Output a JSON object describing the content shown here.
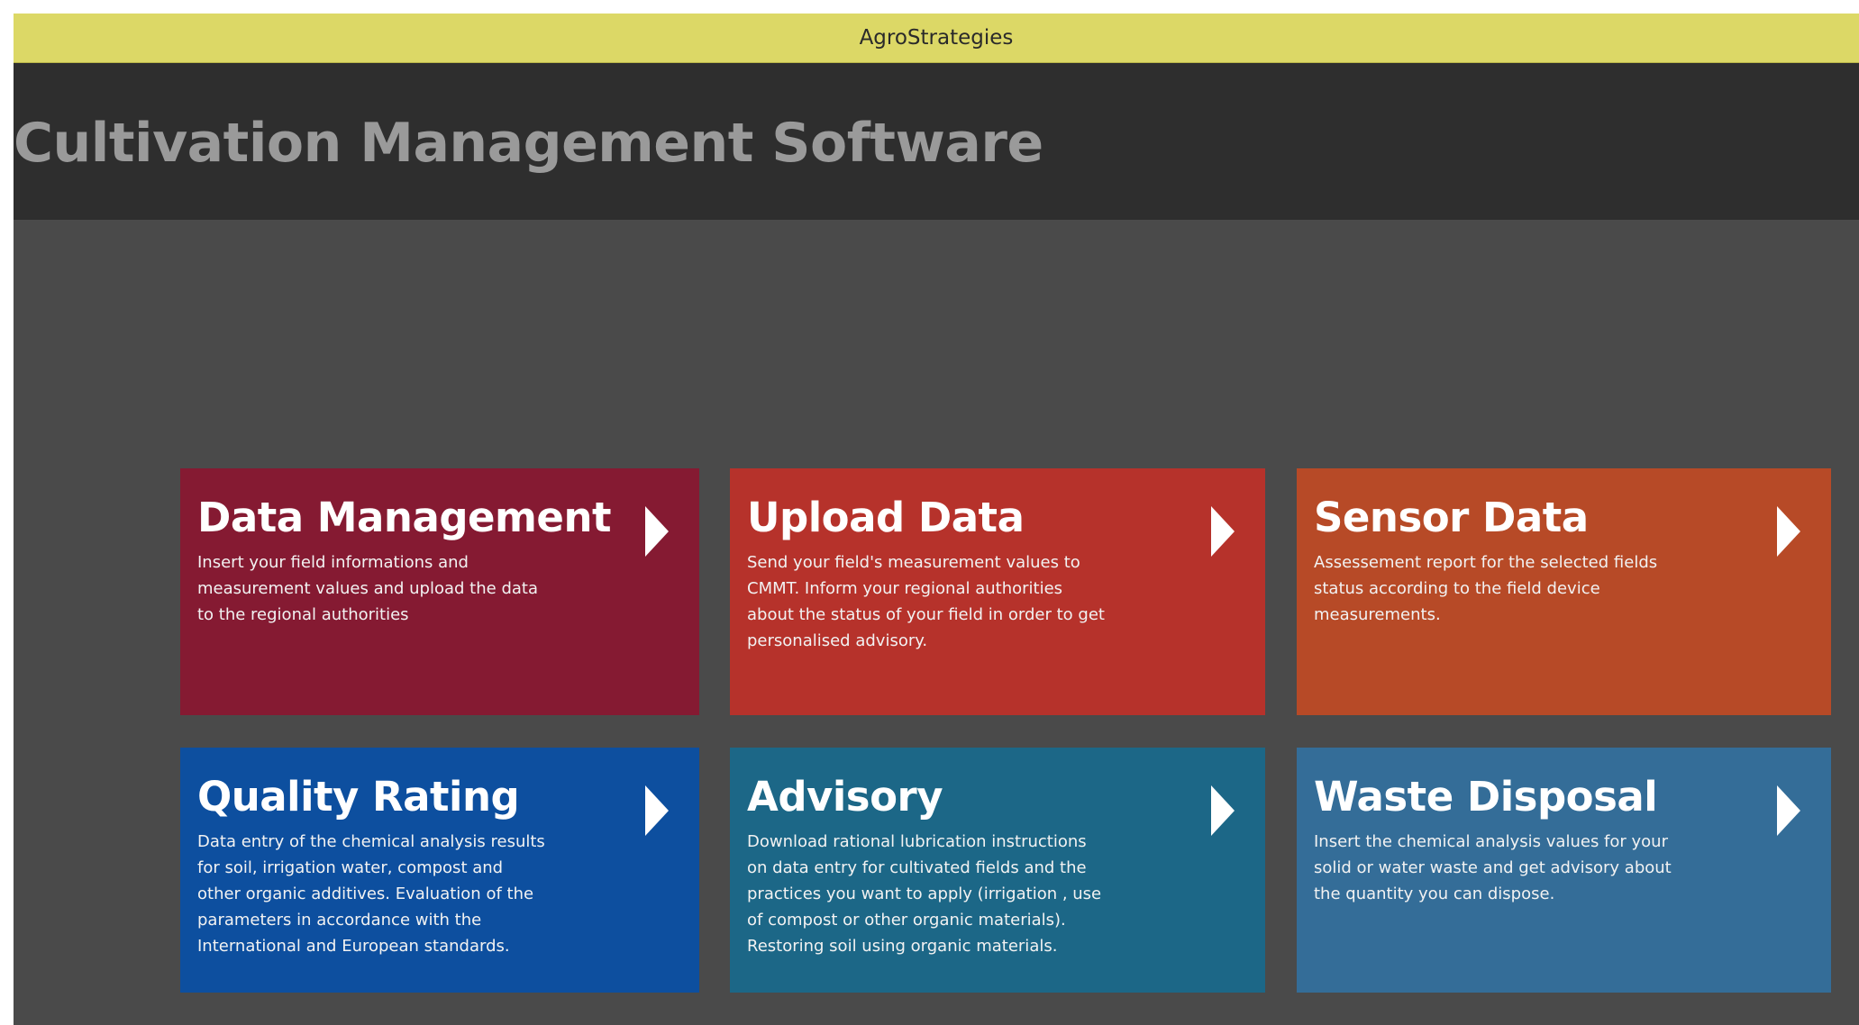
{
  "window": {
    "title": "AgroStrategies"
  },
  "header": {
    "title": "Cultivation Management Software"
  },
  "tiles": [
    {
      "title": "Data Management",
      "description": "Insert your field informations and\nmeasurement values and upload the data\nto the regional authorities",
      "color": "#851a32",
      "icon": "chevron-right-icon"
    },
    {
      "title": "Upload Data",
      "description": "Send your field's measurement values to\nCMMT. Inform your regional authorities\nabout the status of your field in order to get\npersonalised advisory.",
      "color": "#b6322b",
      "icon": "chevron-right-icon"
    },
    {
      "title": "Sensor Data",
      "description": "Assessement report for the selected fields\nstatus according to the field device\nmeasurements.",
      "color": "#b74a27",
      "icon": "chevron-right-icon"
    },
    {
      "title": "Quality Rating",
      "description": "Data entry of the chemical analysis results\nfor soil, irrigation water, compost and\nother organic additives. Evaluation of the\nparameters in accordance with the\nInternational and European standards.",
      "color": "#0d4f9f",
      "icon": "chevron-right-icon"
    },
    {
      "title": "Advisory",
      "description": "Download rational lubrication instructions\non data entry for cultivated fields and the\npractices you want to apply (irrigation , use\nof compost or other organic materials).\nRestoring soil using organic materials.",
      "color": "#1c6787",
      "icon": "chevron-right-icon"
    },
    {
      "title": "Waste Disposal",
      "description": "Insert the chemical analysis values for your\nsolid or water waste and get advisory about\nthe quantity you can dispose.",
      "color": "#346d98",
      "icon": "chevron-right-icon"
    }
  ]
}
